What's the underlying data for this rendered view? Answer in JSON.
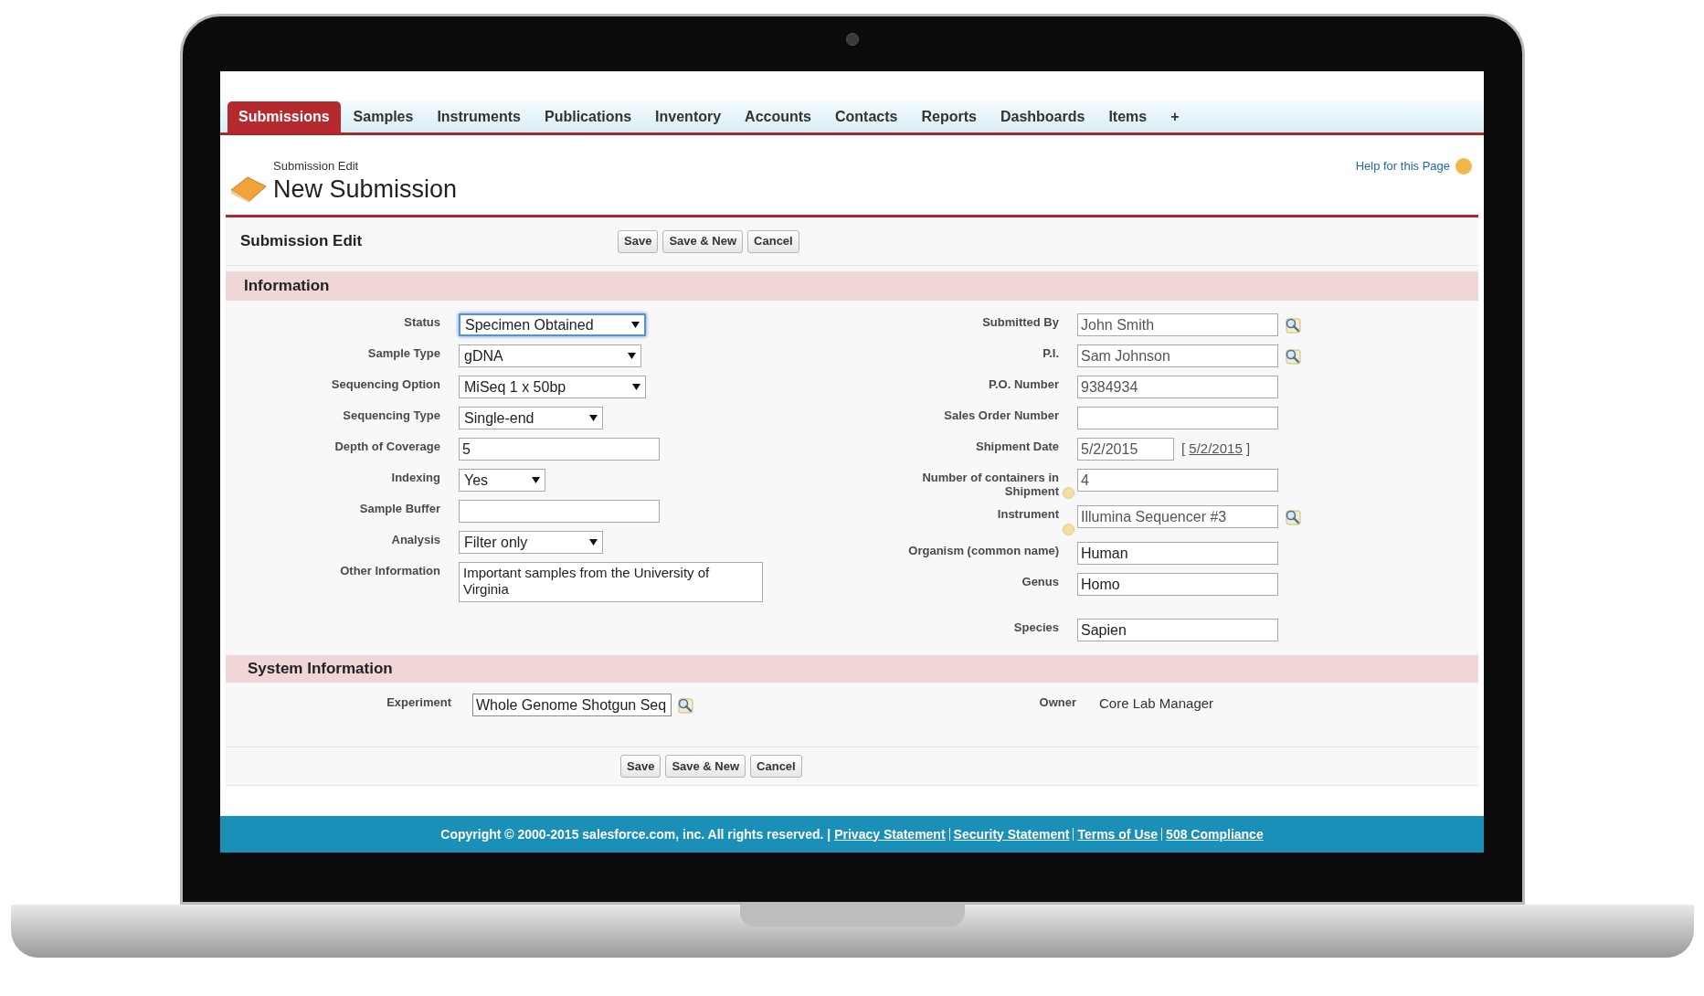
{
  "tabs": [
    {
      "label": "Submissions",
      "selected": true
    },
    {
      "label": "Samples",
      "selected": false
    },
    {
      "label": "Instruments",
      "selected": false
    },
    {
      "label": "Publications",
      "selected": false
    },
    {
      "label": "Inventory",
      "selected": false
    },
    {
      "label": "Accounts",
      "selected": false
    },
    {
      "label": "Contacts",
      "selected": false
    },
    {
      "label": "Reports",
      "selected": false
    },
    {
      "label": "Dashboards",
      "selected": false
    },
    {
      "label": "Items",
      "selected": false
    },
    {
      "label": "+",
      "selected": false
    }
  ],
  "header": {
    "subtitle": "Submission Edit",
    "title": "New Submission",
    "help_link": "Help for this Page"
  },
  "edit_block": {
    "title": "Submission Edit",
    "buttons": [
      "Save",
      "Save & New",
      "Cancel"
    ]
  },
  "information": {
    "title": "Information",
    "left_fields": [
      {
        "label": "Status",
        "kind": "select",
        "value": "Specimen Obtained",
        "focused": true
      },
      {
        "label": "Sample Type",
        "kind": "select",
        "value": "gDNA",
        "focused": false
      },
      {
        "label": "Sequencing Option",
        "kind": "select",
        "value": "MiSeq 1 x 50bp",
        "focused": false
      },
      {
        "label": "Sequencing Type",
        "kind": "select",
        "value": "Single-end",
        "focused": false
      },
      {
        "label": "Depth of Coverage",
        "kind": "text",
        "value": "5",
        "focused": false
      },
      {
        "label": "Indexing",
        "kind": "select",
        "value": "Yes",
        "focused": false
      },
      {
        "label": "Sample Buffer",
        "kind": "text",
        "focused": false
      },
      {
        "label": "Analysis",
        "kind": "select",
        "value": "Filter only",
        "focused": false
      },
      {
        "label": "Other Information",
        "kind": "textarea",
        "value": "Important samples from the University of Virginia",
        "focused": false
      }
    ],
    "right_fields": [
      {
        "label": "Submitted By",
        "kind": "lookup",
        "value": "John Smith",
        "help": false
      },
      {
        "label": "P.I.",
        "kind": "lookup",
        "value": "Sam Johnson",
        "help": false
      },
      {
        "label": "P.O. Number",
        "kind": "text",
        "value": "9384934",
        "help": false
      },
      {
        "label": "Sales Order Number",
        "kind": "text",
        "help": false
      },
      {
        "label": "Shipment Date",
        "kind": "date",
        "value": "5/2/2015",
        "today_open": "[",
        "today": "5/2/2015",
        "today_close": "]",
        "help": false
      },
      {
        "label": "Number of containers in Shipment",
        "kind": "text",
        "value": "4",
        "help": true
      },
      {
        "label": "Instrument",
        "kind": "lookup",
        "value": "Illumina Sequencer #3",
        "help": true
      },
      {
        "label": "Organism (common name)",
        "kind": "text",
        "value": "Human",
        "help": false
      },
      {
        "label": "Genus",
        "kind": "text",
        "value": "Homo",
        "help": false
      },
      {
        "label": "Species",
        "kind": "text",
        "value": "Sapien",
        "help": false
      }
    ]
  },
  "system_information": {
    "title": "System Information",
    "experiment_label": "Experiment",
    "experiment_value": "Whole Genome Shotgun Seq",
    "owner_label": "Owner",
    "owner_value": "Core Lab Manager"
  },
  "bottom_buttons": [
    "Save",
    "Save & New",
    "Cancel"
  ],
  "footer": {
    "copyright": "Copyright © 2000-2015 salesforce.com, inc. All rights reserved. |",
    "links": [
      "Privacy Statement",
      "Security Statement",
      "Terms of Use",
      "508 Compliance"
    ]
  }
}
